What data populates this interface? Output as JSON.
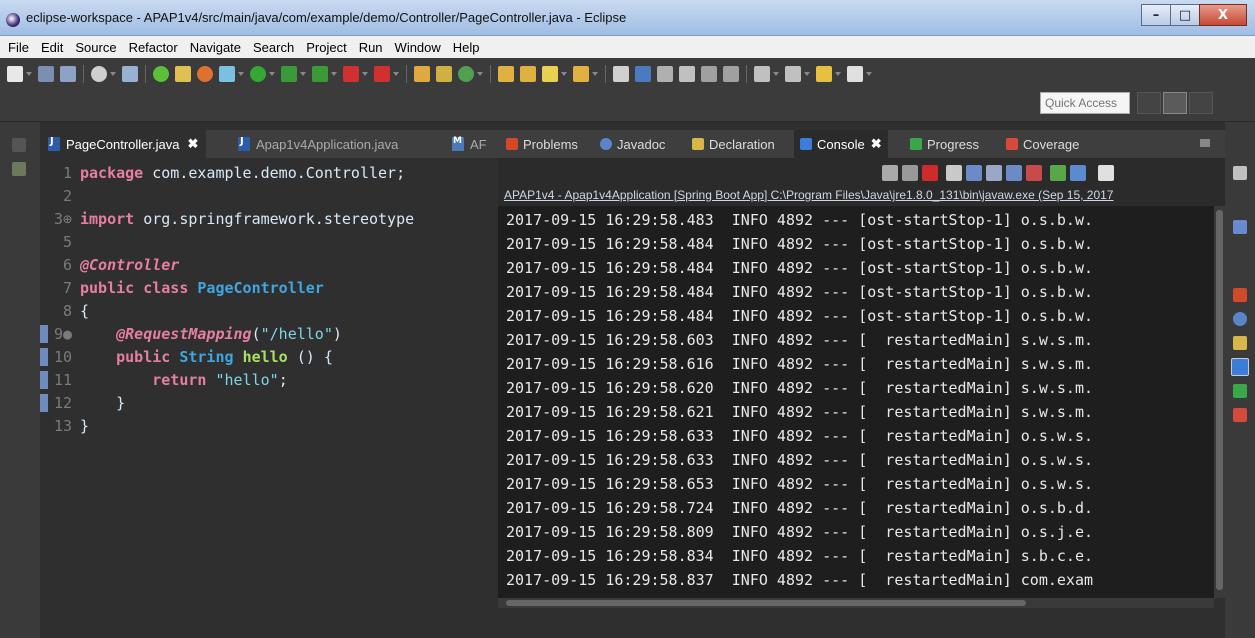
{
  "window": {
    "title": "eclipse-workspace - APAP1v4/src/main/java/com/example/demo/Controller/PageController.java - Eclipse",
    "minimize_label": "–",
    "maximize_label": "□",
    "close_label": "X"
  },
  "menu": [
    "File",
    "Edit",
    "Source",
    "Refactor",
    "Navigate",
    "Search",
    "Project",
    "Run",
    "Window",
    "Help"
  ],
  "toolbar": {
    "quick_access_placeholder": "Quick Access"
  },
  "editor": {
    "tabs": [
      {
        "label": "PageController.java",
        "close": "✖"
      },
      {
        "label": "Apap1v4Application.java"
      },
      {
        "label": "AF"
      }
    ],
    "lines": [
      {
        "n": "1",
        "parts": [
          {
            "t": "package",
            "c": "kw"
          },
          {
            "t": " com.example.demo.Controller;",
            "c": "plain"
          }
        ]
      },
      {
        "n": "2",
        "parts": []
      },
      {
        "n": "3⊕",
        "parts": [
          {
            "t": "import",
            "c": "kw"
          },
          {
            "t": " org.springframework.stereotype",
            "c": "plain"
          }
        ]
      },
      {
        "n": "5",
        "parts": []
      },
      {
        "n": "6",
        "parts": [
          {
            "t": "@Controller",
            "c": "ann"
          }
        ]
      },
      {
        "n": "7",
        "parts": [
          {
            "t": "public class ",
            "c": "kw"
          },
          {
            "t": "PageController",
            "c": "cls"
          }
        ]
      },
      {
        "n": "8",
        "parts": [
          {
            "t": "{",
            "c": "plain"
          }
        ]
      },
      {
        "n": "9●",
        "parts": [
          {
            "t": "    ",
            "c": "plain"
          },
          {
            "t": "@RequestMapping",
            "c": "ann"
          },
          {
            "t": "(",
            "c": "plain"
          },
          {
            "t": "\"/hello\"",
            "c": "str"
          },
          {
            "t": ")",
            "c": "plain"
          }
        ]
      },
      {
        "n": "10",
        "parts": [
          {
            "t": "    ",
            "c": "plain"
          },
          {
            "t": "public ",
            "c": "kw"
          },
          {
            "t": "String ",
            "c": "cls"
          },
          {
            "t": "hello",
            "c": "fn"
          },
          {
            "t": " () {",
            "c": "plain"
          }
        ]
      },
      {
        "n": "11",
        "parts": [
          {
            "t": "        ",
            "c": "plain"
          },
          {
            "t": "return ",
            "c": "kw"
          },
          {
            "t": "\"hello\"",
            "c": "str"
          },
          {
            "t": ";",
            "c": "plain"
          }
        ]
      },
      {
        "n": "12",
        "parts": [
          {
            "t": "    }",
            "c": "plain"
          }
        ]
      },
      {
        "n": "13",
        "parts": [
          {
            "t": "}",
            "c": "plain"
          }
        ]
      }
    ]
  },
  "console": {
    "tabs": [
      {
        "label": "Problems",
        "icon": "problems-icon"
      },
      {
        "label": "Javadoc",
        "icon": "javadoc-icon"
      },
      {
        "label": "Declaration",
        "icon": "declaration-icon"
      },
      {
        "label": "Console",
        "icon": "console-icon",
        "close": "✖"
      },
      {
        "label": "Progress",
        "icon": "progress-icon"
      },
      {
        "label": "Coverage",
        "icon": "coverage-icon"
      }
    ],
    "header": "APAP1v4 - Apap1v4Application [Spring Boot App] C:\\Program Files\\Java\\jre1.8.0_131\\bin\\javaw.exe (Sep 15, 2017",
    "lines": [
      "2017-09-15 16:29:58.483  INFO 4892 --- [ost-startStop-1] o.s.b.w.",
      "2017-09-15 16:29:58.484  INFO 4892 --- [ost-startStop-1] o.s.b.w.",
      "2017-09-15 16:29:58.484  INFO 4892 --- [ost-startStop-1] o.s.b.w.",
      "2017-09-15 16:29:58.484  INFO 4892 --- [ost-startStop-1] o.s.b.w.",
      "2017-09-15 16:29:58.484  INFO 4892 --- [ost-startStop-1] o.s.b.w.",
      "2017-09-15 16:29:58.603  INFO 4892 --- [  restartedMain] s.w.s.m.",
      "2017-09-15 16:29:58.616  INFO 4892 --- [  restartedMain] s.w.s.m.",
      "2017-09-15 16:29:58.620  INFO 4892 --- [  restartedMain] s.w.s.m.",
      "2017-09-15 16:29:58.621  INFO 4892 --- [  restartedMain] s.w.s.m.",
      "2017-09-15 16:29:58.633  INFO 4892 --- [  restartedMain] o.s.w.s.",
      "2017-09-15 16:29:58.633  INFO 4892 --- [  restartedMain] o.s.w.s.",
      "2017-09-15 16:29:58.653  INFO 4892 --- [  restartedMain] o.s.w.s.",
      "2017-09-15 16:29:58.724  INFO 4892 --- [  restartedMain] o.s.b.d.",
      "2017-09-15 16:29:58.809  INFO 4892 --- [  restartedMain] o.s.j.e.",
      "2017-09-15 16:29:58.834  INFO 4892 --- [  restartedMain] s.b.c.e.",
      "2017-09-15 16:29:58.837  INFO 4892 --- [  restartedMain] com.exam"
    ]
  },
  "colors": {
    "keyword": "#e67ea4",
    "class": "#3fa6e0",
    "string": "#7ed6e6",
    "method": "#a8e063",
    "console_bg": "#1e1e1e",
    "editor_bg": "#2f2f2f"
  }
}
